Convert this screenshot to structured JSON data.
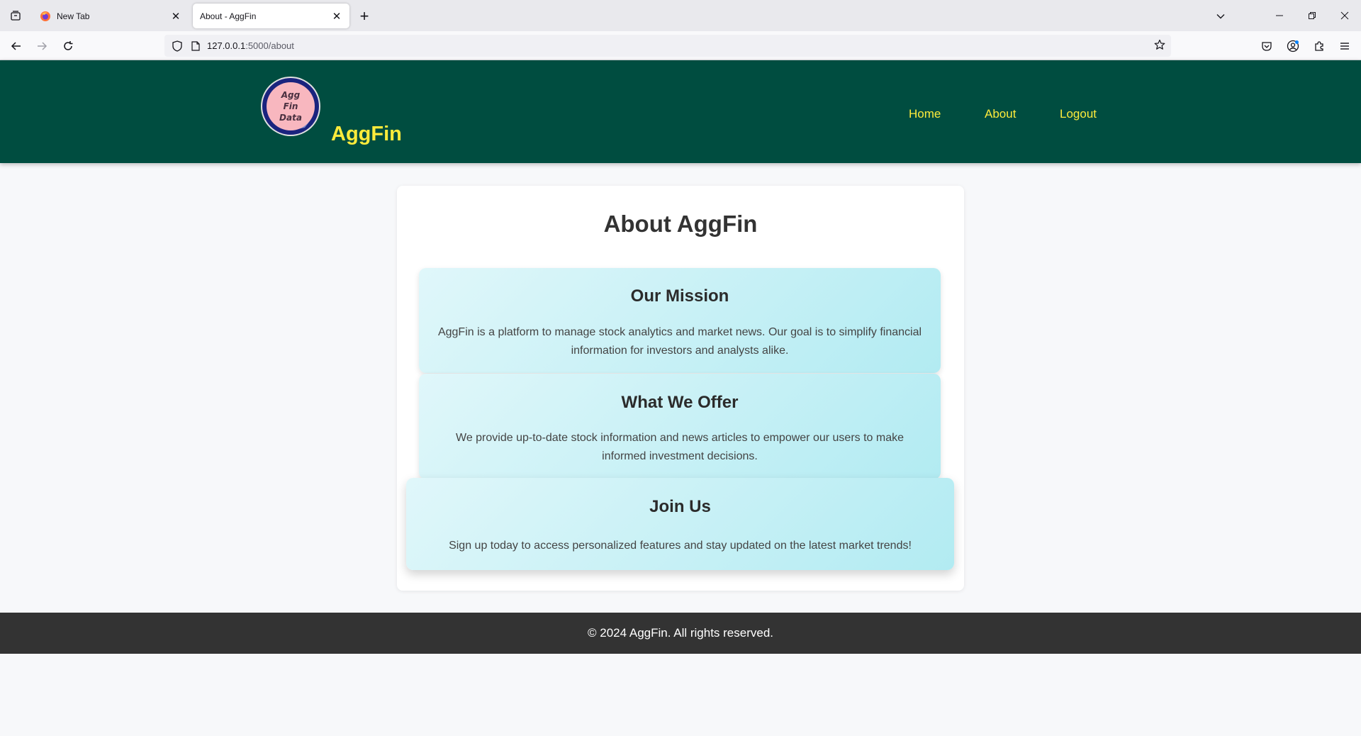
{
  "browser": {
    "tabs": [
      {
        "title": "New Tab",
        "active": false
      },
      {
        "title": "About - AggFin",
        "active": true
      }
    ],
    "url_host": "127.0.0.1",
    "url_path": ":5000/about"
  },
  "site": {
    "logo_text": [
      "Agg",
      "Fin",
      "Data"
    ],
    "brand": "AggFin",
    "nav": [
      "Home",
      "About",
      "Logout"
    ]
  },
  "main": {
    "heading": "About AggFin",
    "sections": [
      {
        "title": "Our Mission",
        "text": "AggFin is a platform to manage stock analytics and market news. Our goal is to simplify financial information for investors and analysts alike."
      },
      {
        "title": "What We Offer",
        "text": "We provide up-to-date stock information and news articles to empower our users to make informed investment decisions."
      },
      {
        "title": "Join Us",
        "text": "Sign up today to access personalized features and stay updated on the latest market trends!"
      }
    ]
  },
  "footer": {
    "text": "© 2024 AggFin. All rights reserved."
  },
  "colors": {
    "header_bg": "#004d40",
    "accent": "#ffeb3b",
    "footer_bg": "#333333",
    "section_gradient_start": "#e0f7fa",
    "section_gradient_end": "#b2ebf2"
  },
  "icons": [
    "tab-list-icon",
    "firefox-icon",
    "close-icon",
    "plus-icon",
    "chevron-down-icon",
    "minimize-icon",
    "restore-icon",
    "back-icon",
    "forward-icon",
    "reload-icon",
    "shield-icon",
    "page-icon",
    "star-icon",
    "pocket-icon",
    "account-icon",
    "extensions-icon",
    "menu-icon"
  ]
}
